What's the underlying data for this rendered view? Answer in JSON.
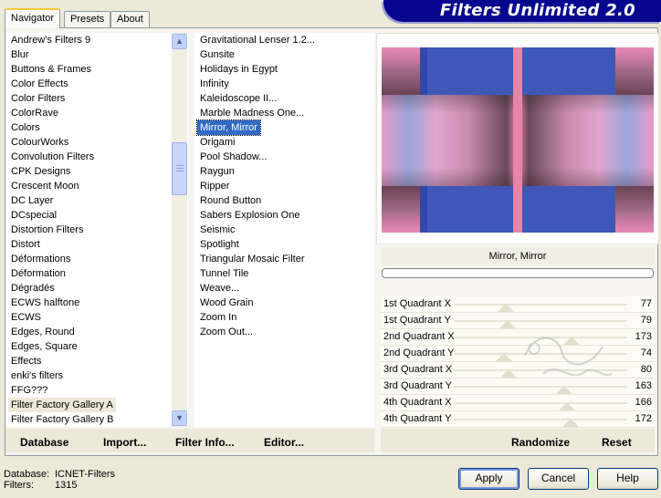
{
  "app_title": "Filters Unlimited 2.0",
  "tabs": [
    {
      "label": "Navigator",
      "active": true
    },
    {
      "label": "Presets",
      "active": false
    },
    {
      "label": "About",
      "active": false
    }
  ],
  "categories": [
    "Andrew's Filters 9",
    "Blur",
    "Buttons & Frames",
    "Color Effects",
    "Color Filters",
    "ColorRave",
    "Colors",
    "ColourWorks",
    "Convolution Filters",
    "CPK Designs",
    "Crescent Moon",
    "DC Layer",
    "DCspecial",
    "Distortion Filters",
    "Distort",
    "Déformations",
    "Déformation",
    "Dégradés",
    "ECWS halftone",
    "ECWS",
    "Edges, Round",
    "Edges, Square",
    "Effects",
    "enki's filters",
    "FFG???",
    "Filter Factory Gallery A",
    "Filter Factory Gallery B"
  ],
  "selected_category": "Filter Factory Gallery A",
  "filters": [
    "Gravitational Lenser 1.2...",
    "Gunsite",
    "Holidays in Egypt",
    "Infinity",
    "Kaleidoscope II...",
    "Marble Madness One...",
    "Mirror, Mirror",
    "Origami",
    "Pool Shadow...",
    "Raygun",
    "Ripper",
    "Round Button",
    "Sabers Explosion One",
    "Seismic",
    "Spotlight",
    "Triangular Mosaic Filter",
    "Tunnel Tile",
    "Weave...",
    "Wood Grain",
    "Zoom In",
    "Zoom Out..."
  ],
  "selected_filter": "Mirror, Mirror",
  "left_buttons": {
    "database": "Database",
    "import": "Import...",
    "filter_info": "Filter Info...",
    "editor": "Editor..."
  },
  "preview": {
    "filter_name": "Mirror, Mirror",
    "colors": {
      "blue": "#3f58b8",
      "pink": "#e6a0c8",
      "mauve": "#8a5a78",
      "light_blue": "#8ab0e0",
      "stripe": "#e884a8"
    }
  },
  "parameters": [
    {
      "name": "1st Quadrant X",
      "value": 77
    },
    {
      "name": "1st Quadrant Y",
      "value": 79
    },
    {
      "name": "2nd Quadrant X",
      "value": 173
    },
    {
      "name": "2nd Quadrant Y",
      "value": 74
    },
    {
      "name": "3rd Quadrant X",
      "value": 80
    },
    {
      "name": "3rd Quadrant Y",
      "value": 163
    },
    {
      "name": "4th Quadrant X",
      "value": 166
    },
    {
      "name": "4th Quadrant Y",
      "value": 172
    }
  ],
  "param_max": 255,
  "right_buttons": {
    "randomize": "Randomize",
    "reset": "Reset"
  },
  "status": {
    "database_label": "Database:",
    "database_value": "ICNET-Filters",
    "filters_label": "Filters:",
    "filters_value": "1315"
  },
  "dialog_buttons": {
    "apply": "Apply",
    "cancel": "Cancel",
    "help": "Help"
  }
}
